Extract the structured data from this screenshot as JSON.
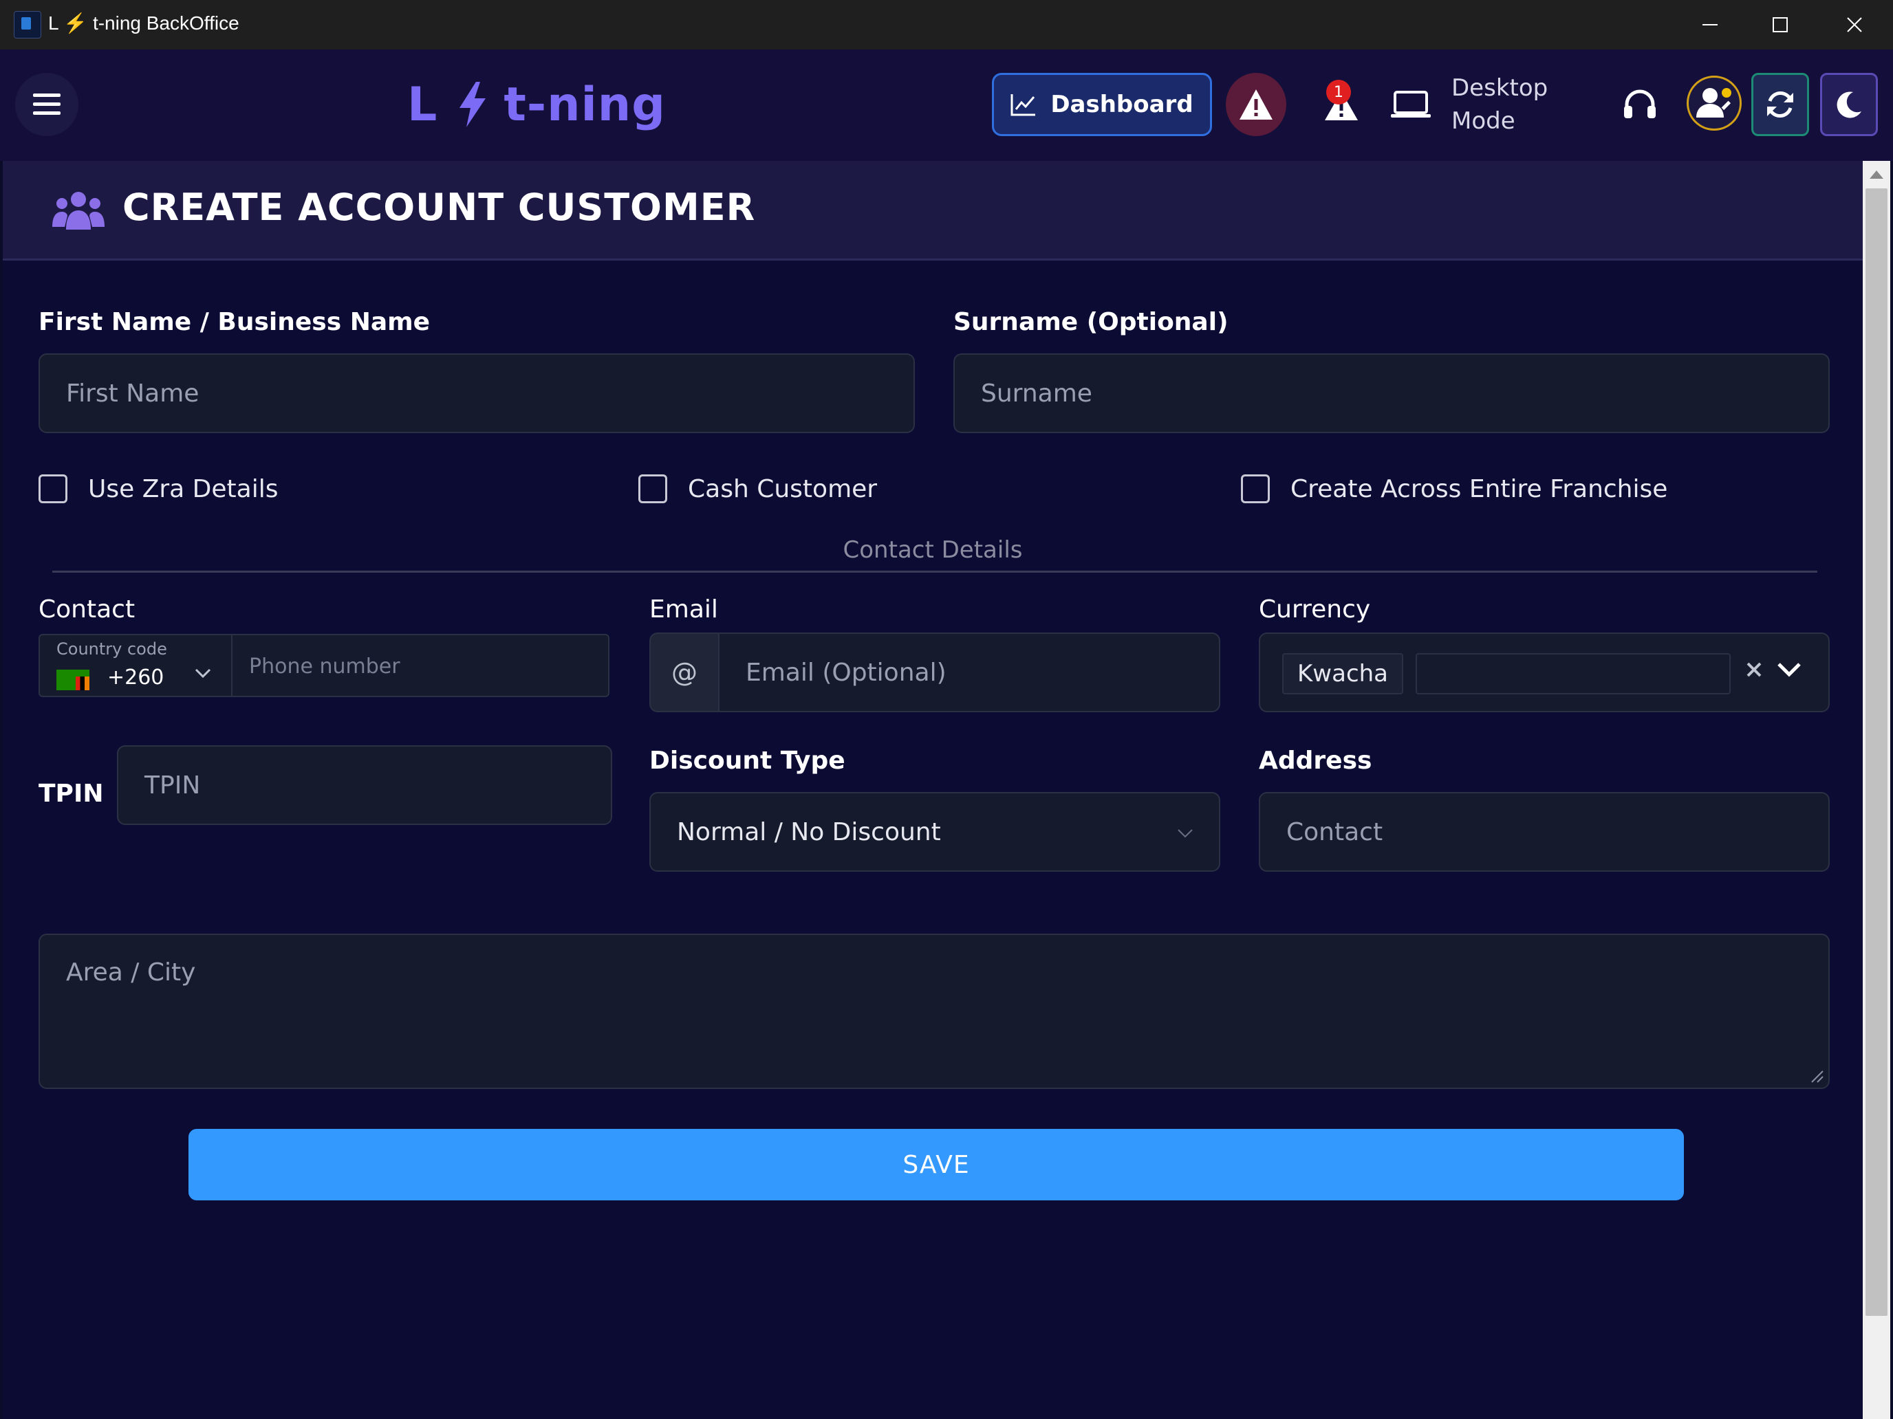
{
  "window": {
    "title": "L ⚡ t-ning BackOffice",
    "controls": [
      "minimize",
      "maximize",
      "close"
    ]
  },
  "header": {
    "logo_left": "L",
    "logo_right": "t-ning",
    "dashboard_label": "Dashboard",
    "notification_count": "1",
    "desktop_mode_line1": "Desktop",
    "desktop_mode_line2": "Mode",
    "icons": [
      "menu-icon",
      "chart-icon",
      "warning-icon",
      "alert-icon",
      "laptop-icon",
      "headset-icon",
      "user-edit-icon",
      "refresh-icon",
      "moon-icon"
    ]
  },
  "card": {
    "title": "CREATE ACCOUNT CUSTOMER",
    "title_icon": "users-icon"
  },
  "form": {
    "first_name": {
      "label": "First Name / Business Name",
      "placeholder": "First Name"
    },
    "surname": {
      "label": "Surname (Optional)",
      "placeholder": "Surname"
    },
    "checkboxes": [
      {
        "label": "Use Zra Details",
        "checked": false
      },
      {
        "label": "Cash Customer",
        "checked": false
      },
      {
        "label": "Create Across Entire Franchise",
        "checked": false
      }
    ],
    "section_contact": "Contact Details",
    "contact": {
      "label": "Contact",
      "country_code_label": "Country code",
      "country_code_value": "+260",
      "phone_placeholder": "Phone number"
    },
    "email": {
      "label": "Email",
      "prefix": "@",
      "placeholder": "Email (Optional)"
    },
    "currency": {
      "label": "Currency",
      "selected": "Kwacha"
    },
    "tpin": {
      "label": "TPIN",
      "placeholder": "TPIN"
    },
    "discount_type": {
      "label": "Discount Type",
      "value": "Normal / No Discount"
    },
    "address": {
      "label": "Address",
      "placeholder": "Contact"
    },
    "area_city": {
      "placeholder": "Area / City"
    },
    "save_label": "SAVE"
  },
  "colors": {
    "background": "#0b0b2a",
    "header": "#130f3a",
    "accent": "#7c6cf5",
    "save_button": "#3399ff",
    "dashboard_border": "#2f6fe0"
  }
}
